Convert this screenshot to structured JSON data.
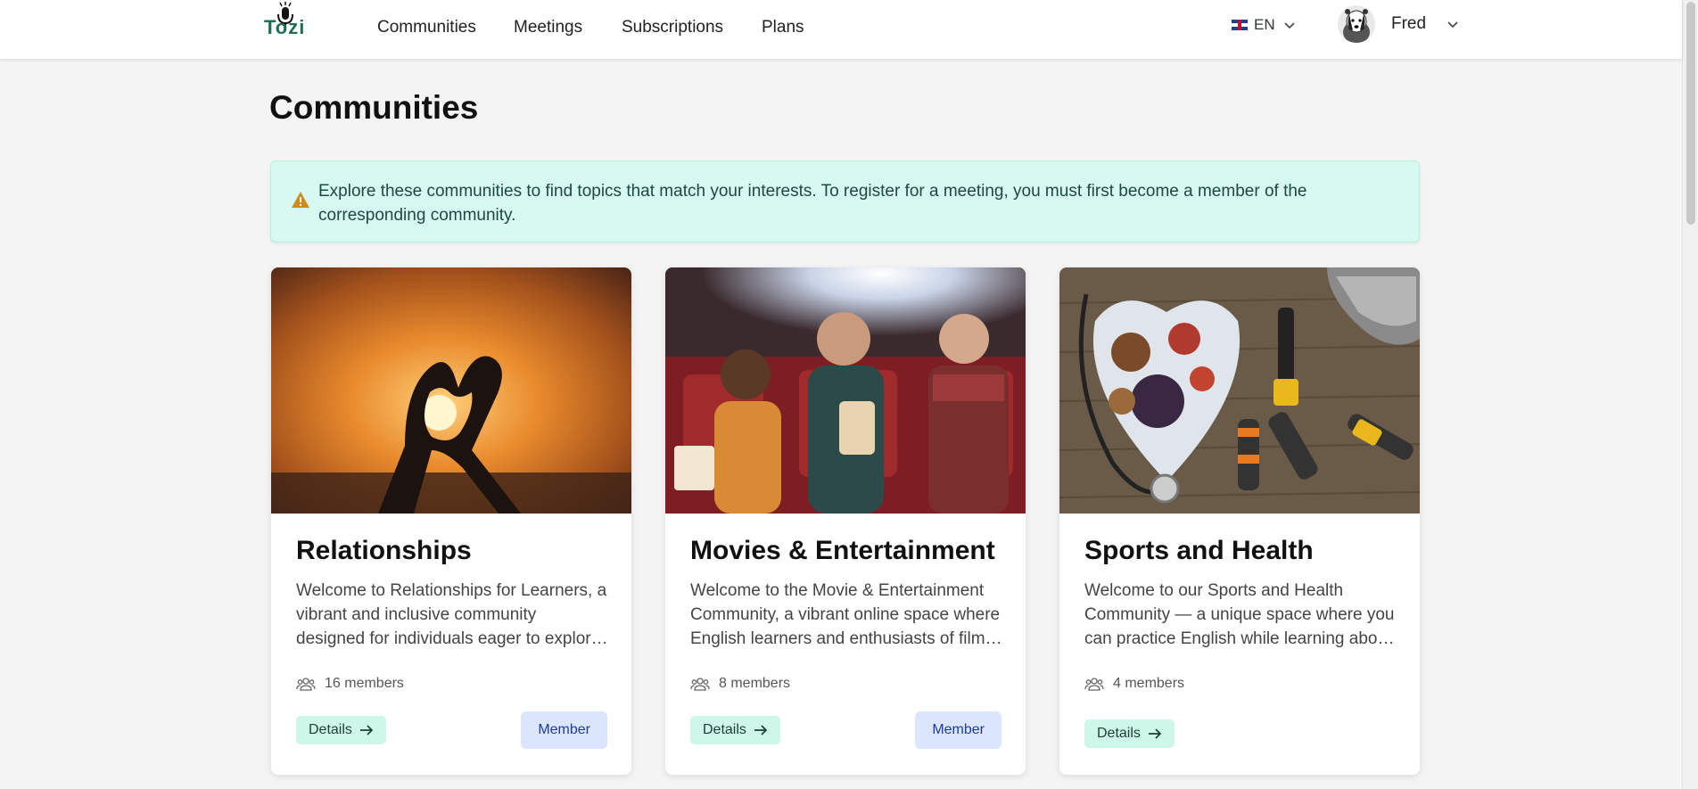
{
  "header": {
    "logo_text": "Tozi",
    "nav": [
      "Communities",
      "Meetings",
      "Subscriptions",
      "Plans"
    ],
    "language": "EN",
    "user_name": "Fred"
  },
  "page": {
    "title": "Communities",
    "notice": "Explore these communities to find topics that match your interests. To register for a meeting, you must first become a member of the corresponding community."
  },
  "cards": [
    {
      "title": "Relationships",
      "description": "Welcome to Relationships for Learners, a vibrant and inclusive community designed for individuals eager to explore, discuss and understand relationships.",
      "members": "16 members",
      "details_label": "Details",
      "member_label": "Member",
      "image": "hands-heart-sunset"
    },
    {
      "title": "Movies & Entertainment",
      "description": "Welcome to the Movie & Entertainment Community, a vibrant online space where English learners and enthusiasts of film come together.",
      "members": "8 members",
      "details_label": "Details",
      "member_label": "Member",
      "image": "cinema-audience"
    },
    {
      "title": "Sports and Health",
      "description": "Welcome to our Sports and Health Community — a unique space where you can practice English while learning about health and fitness.",
      "members": "4 members",
      "details_label": "Details",
      "member_label": "",
      "image": "fitness-healthy-food"
    }
  ],
  "colors": {
    "accent_mint": "#cdf7e9",
    "member_blue": "#dbe5fb",
    "notice_bg": "#d6faf0"
  }
}
